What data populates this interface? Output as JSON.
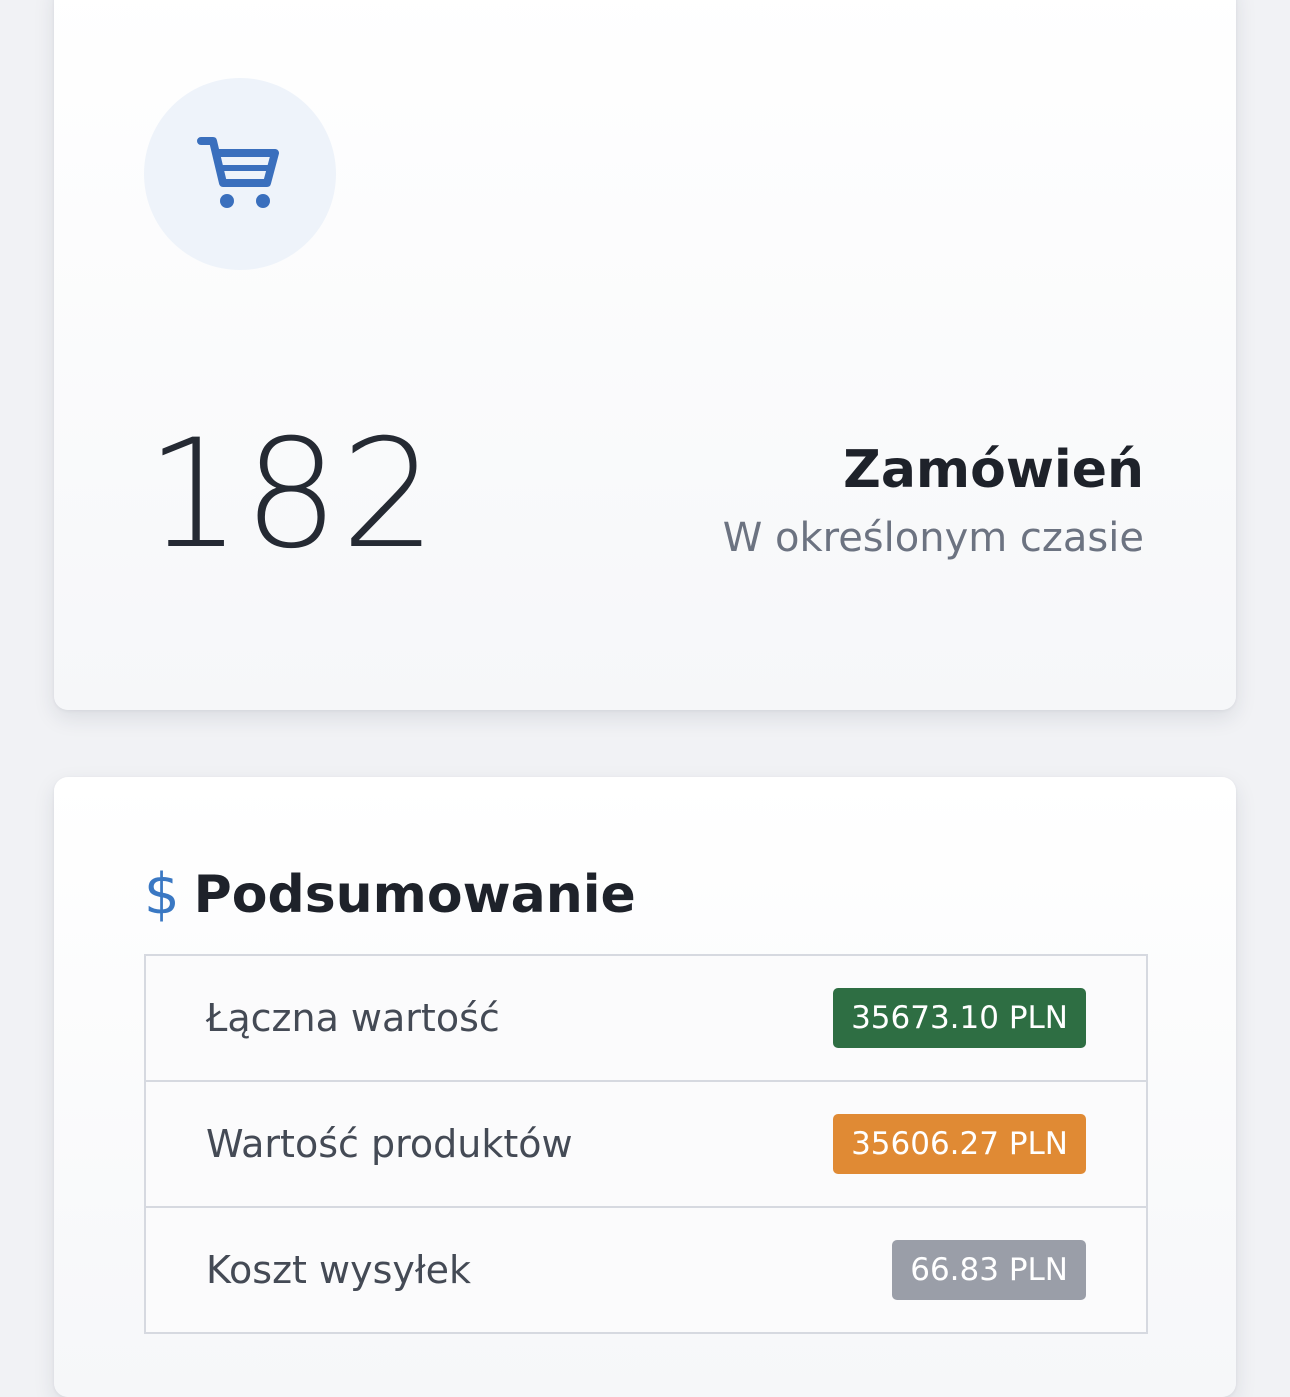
{
  "orders_card": {
    "icon": "shopping-cart-icon",
    "count": "182",
    "title": "Zamówień",
    "subtitle": "W określonym czasie"
  },
  "summary": {
    "icon": "dollar-icon",
    "icon_glyph": "$",
    "title": "Podsumowanie",
    "rows": [
      {
        "label": "Łączna wartość",
        "value": "35673.10 PLN",
        "badge_color": "#2e6e43"
      },
      {
        "label": "Wartość produktów",
        "value": "35606.27 PLN",
        "badge_color": "#e08a34"
      },
      {
        "label": "Koszt wysyłek",
        "value": "66.83 PLN",
        "badge_color": "#9a9ea8"
      }
    ]
  },
  "colors": {
    "accent": "#3a78c3",
    "page_background": "#f1f2f5"
  }
}
